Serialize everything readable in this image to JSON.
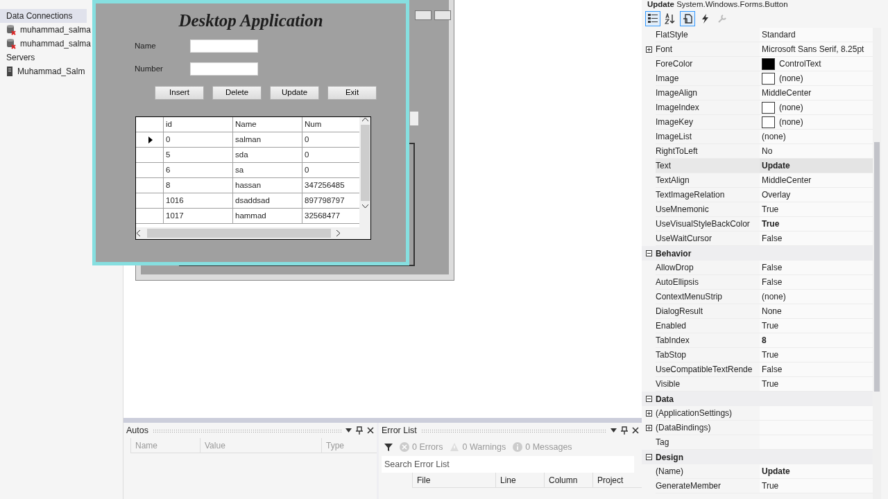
{
  "server_explorer": {
    "items": [
      {
        "label": "Data Connections",
        "kind": "folder",
        "selected": true,
        "children": [
          {
            "label": "muhammad_salma",
            "kind": "database",
            "selected": false
          },
          {
            "label": "muhammad_salma",
            "kind": "database",
            "selected": false
          }
        ]
      },
      {
        "label": "Servers",
        "kind": "folder",
        "selected": false,
        "children": [
          {
            "label": "Muhammad_Salm",
            "kind": "server",
            "selected": false
          }
        ]
      }
    ]
  },
  "app_window": {
    "title": "Desktop Application",
    "fields": [
      {
        "label": "Name"
      },
      {
        "label": "Number"
      }
    ],
    "buttons": [
      "Insert",
      "Delete",
      "Update",
      "Exit"
    ],
    "grid": {
      "columns": [
        "id",
        "Name",
        "Num"
      ],
      "rows": [
        {
          "current": true,
          "cells": [
            "0",
            "salman",
            "0"
          ]
        },
        {
          "current": false,
          "cells": [
            "5",
            "sda",
            "0"
          ]
        },
        {
          "current": false,
          "cells": [
            "6",
            "sa",
            "0"
          ]
        },
        {
          "current": false,
          "cells": [
            "8",
            "hassan",
            "347256485"
          ]
        },
        {
          "current": false,
          "cells": [
            "1016",
            "dsaddsad",
            "897798797"
          ]
        },
        {
          "current": false,
          "cells": [
            "1017",
            "hammad",
            "32568477"
          ]
        }
      ]
    }
  },
  "properties": {
    "object_name": "Update",
    "object_type": "System.Windows.Forms.Button",
    "toolbar": [
      {
        "kind": "categorized",
        "selected": true
      },
      {
        "kind": "alphabetical",
        "selected": false
      },
      {
        "kind": "properties",
        "selected": true
      },
      {
        "kind": "events",
        "selected": false
      },
      {
        "kind": "pages",
        "selected": false
      }
    ],
    "rows": [
      {
        "kind": "property",
        "name": "FlatStyle",
        "value": "Standard",
        "bold": false,
        "selected": false
      },
      {
        "kind": "property",
        "name": "Font",
        "value": "Microsoft Sans Serif, 8.25pt",
        "bold": false,
        "selected": false,
        "expanded": false
      },
      {
        "kind": "property",
        "name": "ForeColor",
        "value": "ControlText",
        "bold": false,
        "selected": false,
        "color": "#000000"
      },
      {
        "kind": "property",
        "name": "Image",
        "value": "(none)",
        "bold": false,
        "selected": false,
        "color": "#ffffff"
      },
      {
        "kind": "property",
        "name": "ImageAlign",
        "value": "MiddleCenter",
        "bold": false,
        "selected": false
      },
      {
        "kind": "property",
        "name": "ImageIndex",
        "value": "(none)",
        "bold": false,
        "selected": false,
        "color": "#ffffff"
      },
      {
        "kind": "property",
        "name": "ImageKey",
        "value": "(none)",
        "bold": false,
        "selected": false,
        "color": "#ffffff"
      },
      {
        "kind": "property",
        "name": "ImageList",
        "value": "(none)",
        "bold": false,
        "selected": false
      },
      {
        "kind": "property",
        "name": "RightToLeft",
        "value": "No",
        "bold": false,
        "selected": false
      },
      {
        "kind": "property",
        "name": "Text",
        "value": "Update",
        "bold": true,
        "selected": true
      },
      {
        "kind": "property",
        "name": "TextAlign",
        "value": "MiddleCenter",
        "bold": false,
        "selected": false
      },
      {
        "kind": "property",
        "name": "TextImageRelation",
        "value": "Overlay",
        "bold": false,
        "selected": false
      },
      {
        "kind": "property",
        "name": "UseMnemonic",
        "value": "True",
        "bold": false,
        "selected": false
      },
      {
        "kind": "property",
        "name": "UseVisualStyleBackColor",
        "value": "True",
        "bold": true,
        "selected": false
      },
      {
        "kind": "property",
        "name": "UseWaitCursor",
        "value": "False",
        "bold": false,
        "selected": false
      },
      {
        "kind": "category",
        "name": "Behavior",
        "expanded": true,
        "selected": false
      },
      {
        "kind": "property",
        "name": "AllowDrop",
        "value": "False",
        "bold": false,
        "selected": false
      },
      {
        "kind": "property",
        "name": "AutoEllipsis",
        "value": "False",
        "bold": false,
        "selected": false
      },
      {
        "kind": "property",
        "name": "ContextMenuStrip",
        "value": "(none)",
        "bold": false,
        "selected": false
      },
      {
        "kind": "property",
        "name": "DialogResult",
        "value": "None",
        "bold": false,
        "selected": false
      },
      {
        "kind": "property",
        "name": "Enabled",
        "value": "True",
        "bold": false,
        "selected": false
      },
      {
        "kind": "property",
        "name": "TabIndex",
        "value": "8",
        "bold": true,
        "selected": false
      },
      {
        "kind": "property",
        "name": "TabStop",
        "value": "True",
        "bold": false,
        "selected": false
      },
      {
        "kind": "property",
        "name": "UseCompatibleTextRende",
        "value": "False",
        "bold": false,
        "selected": false
      },
      {
        "kind": "property",
        "name": "Visible",
        "value": "True",
        "bold": false,
        "selected": false
      },
      {
        "kind": "category",
        "name": "Data",
        "expanded": true,
        "selected": false
      },
      {
        "kind": "property",
        "name": "(ApplicationSettings)",
        "selected": false,
        "expanded": false
      },
      {
        "kind": "property",
        "name": "(DataBindings)",
        "selected": false,
        "expanded": false
      },
      {
        "kind": "property",
        "name": "Tag",
        "selected": false
      },
      {
        "kind": "category",
        "name": "Design",
        "expanded": true,
        "selected": false
      },
      {
        "kind": "property",
        "name": "(Name)",
        "value": "Update",
        "bold": true,
        "selected": false
      },
      {
        "kind": "property",
        "name": "GenerateMember",
        "value": "True",
        "bold": false,
        "selected": false
      }
    ]
  },
  "autos": {
    "title": "Autos",
    "columns": [
      "Name",
      "Value",
      "Type"
    ]
  },
  "error_list": {
    "title": "Error List",
    "filters": [
      {
        "kind": "errors",
        "label": "0 Errors"
      },
      {
        "kind": "warnings",
        "label": "0 Warnings"
      },
      {
        "kind": "messages",
        "label": "0 Messages"
      }
    ],
    "search": {
      "placeholder": "Search Error List"
    },
    "columns": [
      "File",
      "Line",
      "Column",
      "Project"
    ]
  }
}
